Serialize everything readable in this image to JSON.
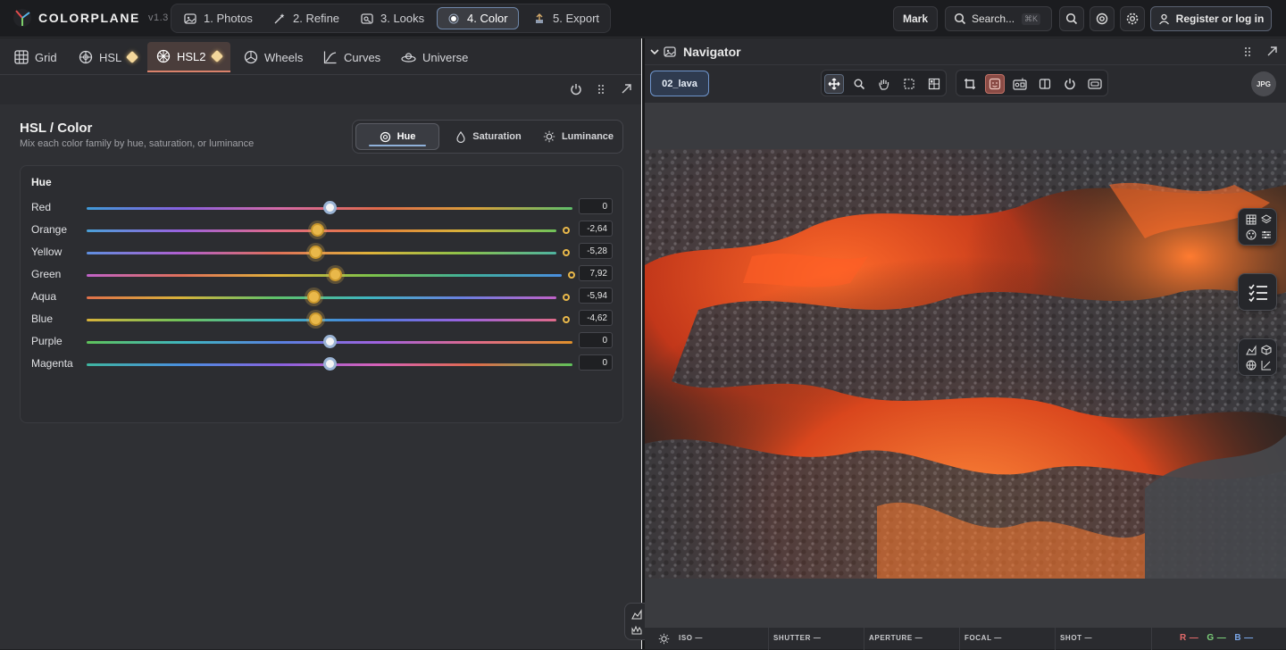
{
  "app": {
    "name": "COLORPLANE",
    "version": "v1.3"
  },
  "steps": [
    {
      "label": "1. Photos",
      "icon": "image-icon"
    },
    {
      "label": "2. Refine",
      "icon": "magic-wand-icon"
    },
    {
      "label": "3. Looks",
      "icon": "looks-icon"
    },
    {
      "label": "4. Color",
      "icon": "color-dot-icon",
      "active": true
    },
    {
      "label": "5. Export",
      "icon": "export-icon"
    }
  ],
  "header": {
    "user_button": "Mark",
    "search_placeholder": "Search...",
    "search_shortcut": "⌘K",
    "register_label": "Register or log in"
  },
  "tool_tabs": [
    {
      "label": "Grid"
    },
    {
      "label": "HSL",
      "badge": true
    },
    {
      "label": "HSL2",
      "badge": true,
      "active": true
    },
    {
      "label": "Wheels"
    },
    {
      "label": "Curves"
    },
    {
      "label": "Universe"
    }
  ],
  "hsl": {
    "title": "HSL / Color",
    "subtitle": "Mix each color family by hue, saturation, or luminance",
    "modes": [
      "Hue",
      "Saturation",
      "Luminance"
    ],
    "active_mode": "Hue",
    "card_title": "Hue",
    "rows": [
      {
        "label": "Red",
        "value": "0",
        "pos": 0.5,
        "modified": false
      },
      {
        "label": "Orange",
        "value": "-2,64",
        "pos": 0.486,
        "modified": true
      },
      {
        "label": "Yellow",
        "value": "-5,28",
        "pos": 0.473,
        "modified": true
      },
      {
        "label": "Green",
        "value": "7,92",
        "pos": 0.54,
        "modified": true
      },
      {
        "label": "Aqua",
        "value": "-5,94",
        "pos": 0.47,
        "modified": true
      },
      {
        "label": "Blue",
        "value": "-4,62",
        "pos": 0.476,
        "modified": true
      },
      {
        "label": "Purple",
        "value": "0",
        "pos": 0.5,
        "modified": false
      },
      {
        "label": "Magenta",
        "value": "0",
        "pos": 0.5,
        "modified": false
      }
    ]
  },
  "navigator": {
    "title": "Navigator",
    "file_chip": "02_lava",
    "format_badge": "JPG"
  },
  "exif": [
    {
      "label": "ISO",
      "value": "—"
    },
    {
      "label": "SHUTTER",
      "value": "—"
    },
    {
      "label": "APERTURE",
      "value": "—"
    },
    {
      "label": "FOCAL",
      "value": "—"
    },
    {
      "label": "SHOT",
      "value": "—"
    }
  ],
  "rgb": {
    "r": "R —",
    "g": "G —",
    "b": "B —"
  },
  "colors": {
    "accent": "#6e86a8",
    "tab_accent": "#d9826b",
    "modified": "#e9b84a",
    "r": "#e26a6a",
    "g": "#7cd07a",
    "b": "#7aa6e8"
  }
}
